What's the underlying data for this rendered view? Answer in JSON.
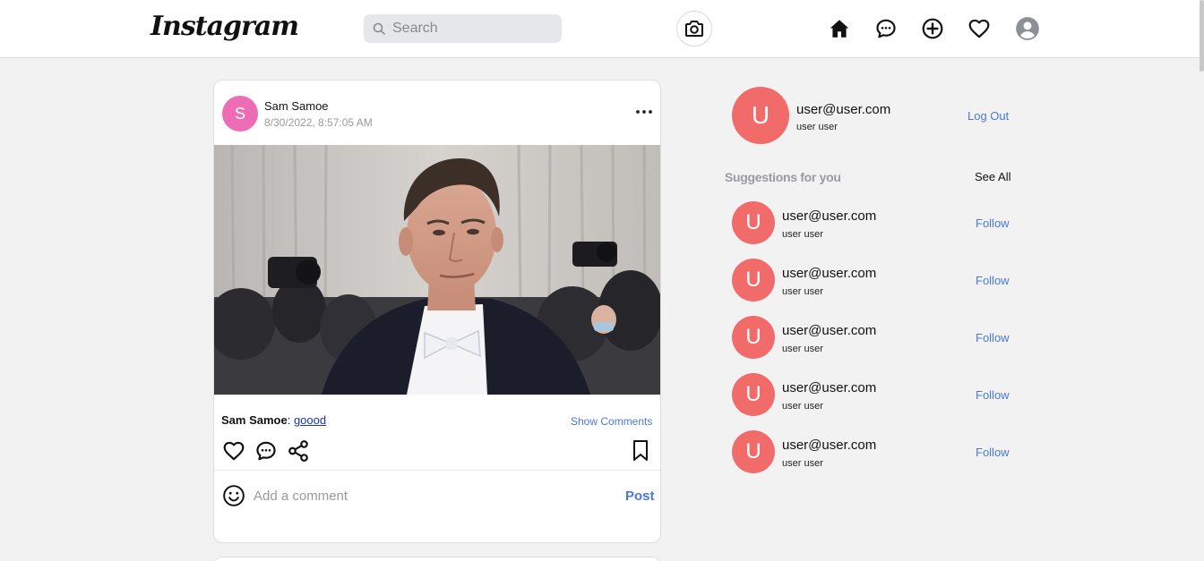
{
  "header": {
    "logo": "Instagram",
    "search_placeholder": "Search",
    "icons": [
      "camera-icon",
      "home-icon",
      "messages-icon",
      "add-post-icon",
      "heart-icon",
      "profile-icon"
    ]
  },
  "post": {
    "author_initial": "S",
    "author": "Sam Samoe",
    "timestamp": "8/30/2022, 8:57:05 AM",
    "caption_author": "Sam Samoe",
    "caption_text": "goood",
    "show_comments": "Show Comments",
    "comment_placeholder": "Add a comment",
    "post_label": "Post"
  },
  "sidebar": {
    "me": {
      "initial": "U",
      "email": "user@user.com",
      "name": "user user",
      "logout": "Log Out"
    },
    "suggestions_title": "Suggestions for you",
    "see_all": "See All",
    "suggestions": [
      {
        "initial": "U",
        "email": "user@user.com",
        "name": "user user",
        "follow": "Follow"
      },
      {
        "initial": "U",
        "email": "user@user.com",
        "name": "user user",
        "follow": "Follow"
      },
      {
        "initial": "U",
        "email": "user@user.com",
        "name": "user user",
        "follow": "Follow"
      },
      {
        "initial": "U",
        "email": "user@user.com",
        "name": "user user",
        "follow": "Follow"
      },
      {
        "initial": "U",
        "email": "user@user.com",
        "name": "user user",
        "follow": "Follow"
      }
    ]
  },
  "colors": {
    "accent": "#4b78d8",
    "avatar_user": "#f26b6b",
    "avatar_post": "#ee6bb5",
    "background": "#f2f2f2"
  }
}
